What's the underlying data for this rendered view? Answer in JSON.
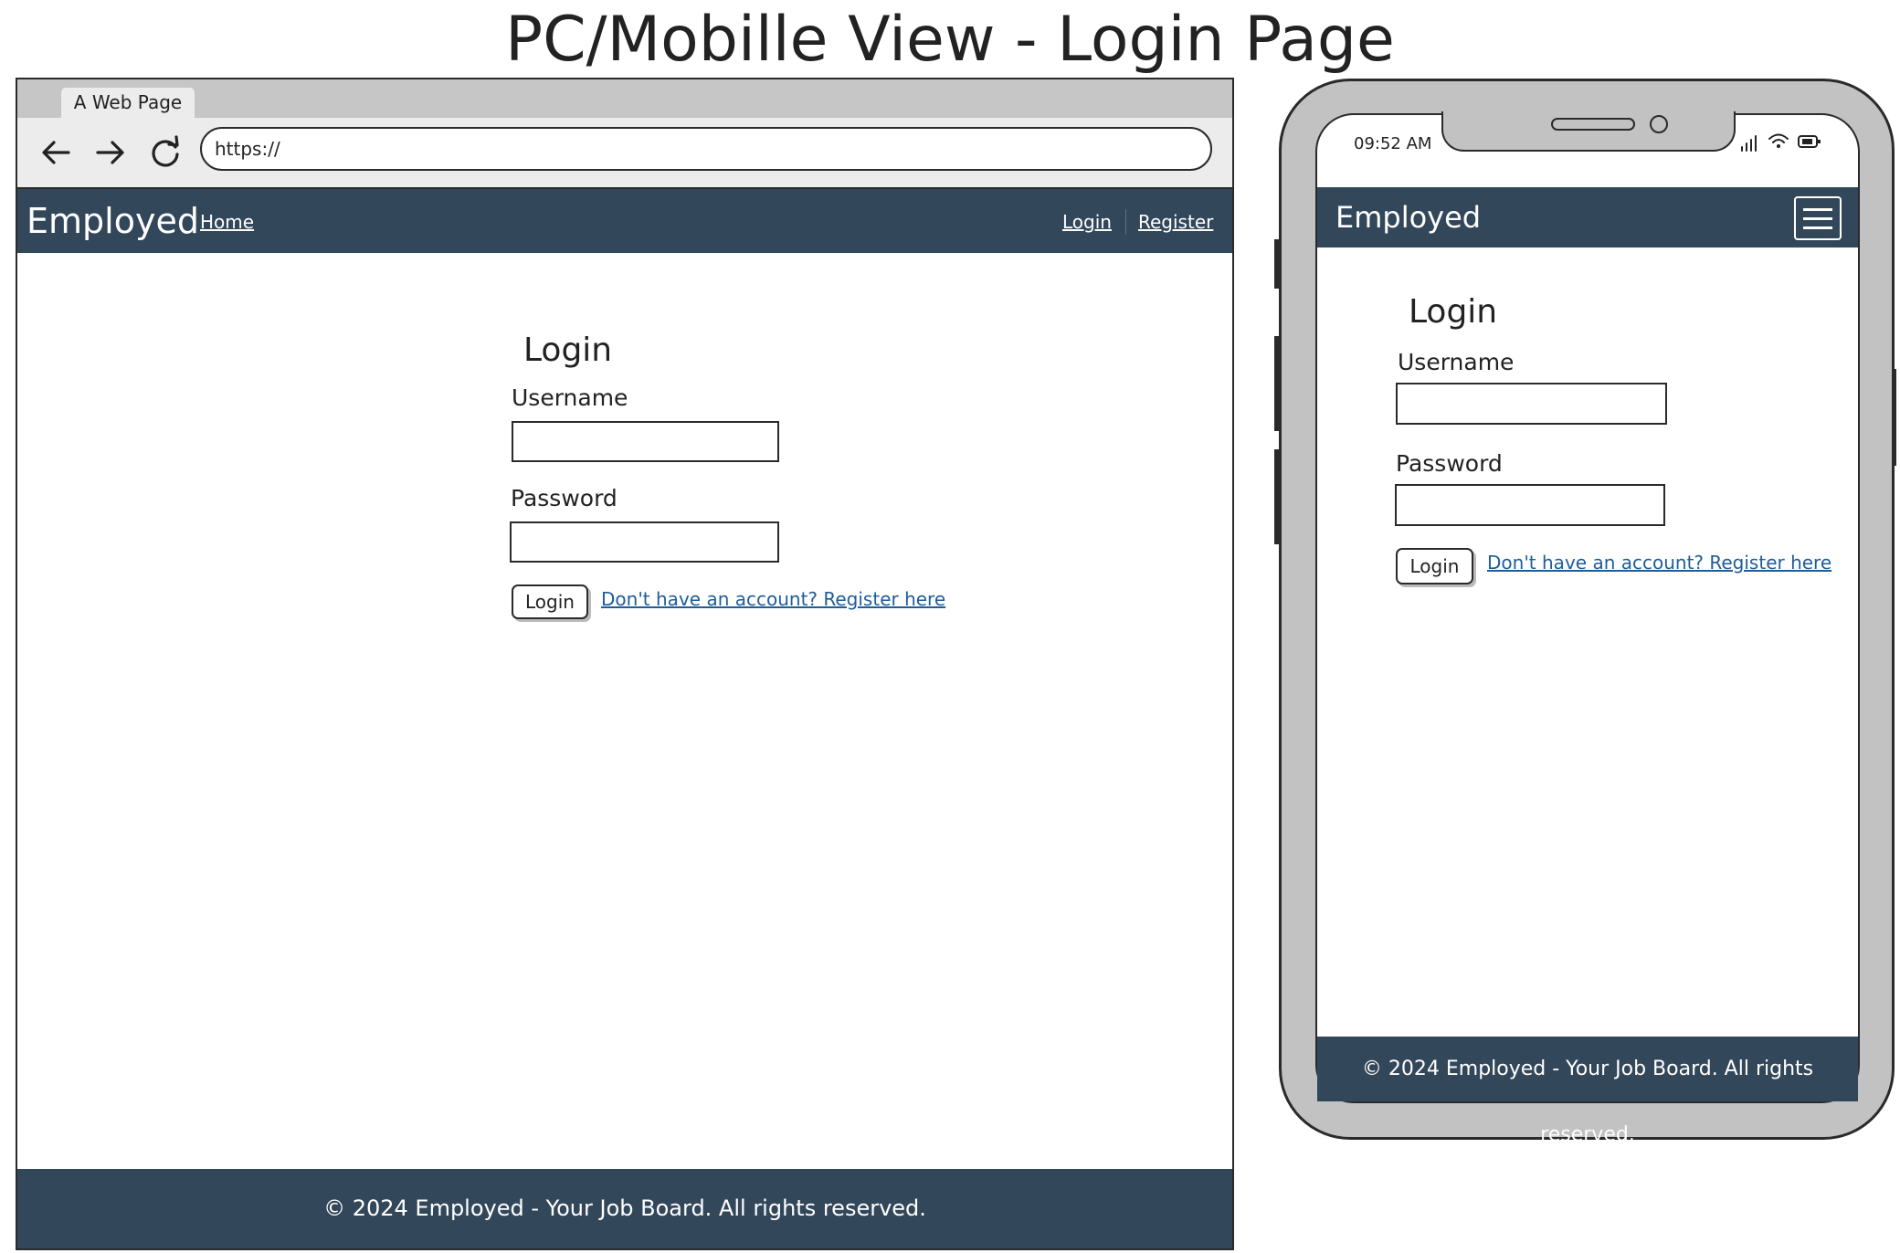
{
  "title": "PC/Mobille View - Login Page",
  "desktop": {
    "browser": {
      "tab_title": "A Web Page",
      "url": "https://",
      "icons": {
        "back": "arrow-left-icon",
        "forward": "arrow-right-icon",
        "reload": "reload-icon"
      }
    },
    "navbar": {
      "brand": "Employed",
      "home": "Home",
      "login": "Login",
      "register": "Register",
      "background": "#33475b"
    },
    "form": {
      "heading": "Login",
      "username_label": "Username",
      "password_label": "Password",
      "submit": "Login",
      "register_link": "Don't have an account? Register here"
    },
    "footer": "© 2024 Employed - Your Job Board. All rights reserved."
  },
  "mobile": {
    "status_bar": {
      "time": "09:52 AM",
      "icons": [
        "signal-icon",
        "wifi-icon",
        "battery-icon"
      ]
    },
    "navbar": {
      "brand": "Employed",
      "menu_icon": "hamburger-menu-icon"
    },
    "form": {
      "heading": "Login",
      "username_label": "Username",
      "password_label": "Password",
      "submit": "Login",
      "register_link": "Don't have an account? Register here"
    },
    "footer": "© 2024 Employed - Your Job Board. All rights reserved."
  },
  "colors": {
    "navbar": "#33475b",
    "link": "#1f5d9b",
    "phone_frame": "#c2c2c2",
    "browser_chrome": "#ececec"
  }
}
